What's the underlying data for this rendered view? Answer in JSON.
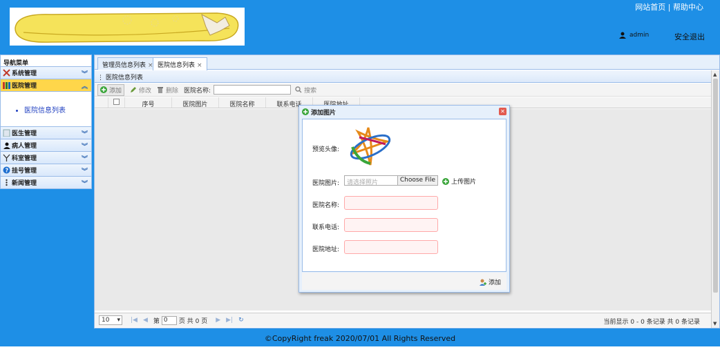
{
  "header": {
    "link_home": "网站首页",
    "link_sep": " | ",
    "link_help": "帮助中心",
    "username": "admin",
    "logout": "安全退出"
  },
  "nav": {
    "title": "导航菜单",
    "items": [
      {
        "label": "系统管理",
        "icon": "tools-icon"
      },
      {
        "label": "医院管理",
        "icon": "books-icon"
      },
      {
        "label": "医生管理",
        "icon": "doctor-icon"
      },
      {
        "label": "病人管理",
        "icon": "user-icon"
      },
      {
        "label": "科室管理",
        "icon": "filter-icon"
      },
      {
        "label": "挂号管理",
        "icon": "help-icon"
      },
      {
        "label": "新闻管理",
        "icon": "menu-dots-icon"
      }
    ],
    "sub_items": [
      "医院信息列表"
    ]
  },
  "tabs": [
    {
      "label": "管理员信息列表"
    },
    {
      "label": "医院信息列表"
    }
  ],
  "panel": {
    "title": "医院信息列表"
  },
  "toolbar": {
    "add": "添加",
    "edit": "修改",
    "delete": "删除",
    "search_label": "医院名称:",
    "search": "搜索"
  },
  "grid": {
    "columns": [
      "序号",
      "医院图片",
      "医院名称",
      "联系电话",
      "医院地址"
    ]
  },
  "pager": {
    "page_size": "10",
    "page_prefix": "第",
    "page_value": "0",
    "page_suffix": "页 共 0 页",
    "info": "当前显示 0 - 0 条记录 共 0 条记录"
  },
  "dialog": {
    "title": "添加图片",
    "preview_label": "预览头像:",
    "image_label": "医院图片:",
    "file_placeholder": "请选择照片",
    "file_button": "Choose File",
    "upload": "上传图片",
    "name_label": "医院名称:",
    "phone_label": "联系电话:",
    "address_label": "医院地址:",
    "submit": "添加"
  },
  "footer": {
    "copyright": "©CopyRight freak 2020/07/01 All Rights Reserved"
  },
  "colors": {
    "primary": "#1e8fe6",
    "border": "#99bbe8",
    "active_nav": "#ffd64a",
    "field_border": "#ffa8a8"
  }
}
